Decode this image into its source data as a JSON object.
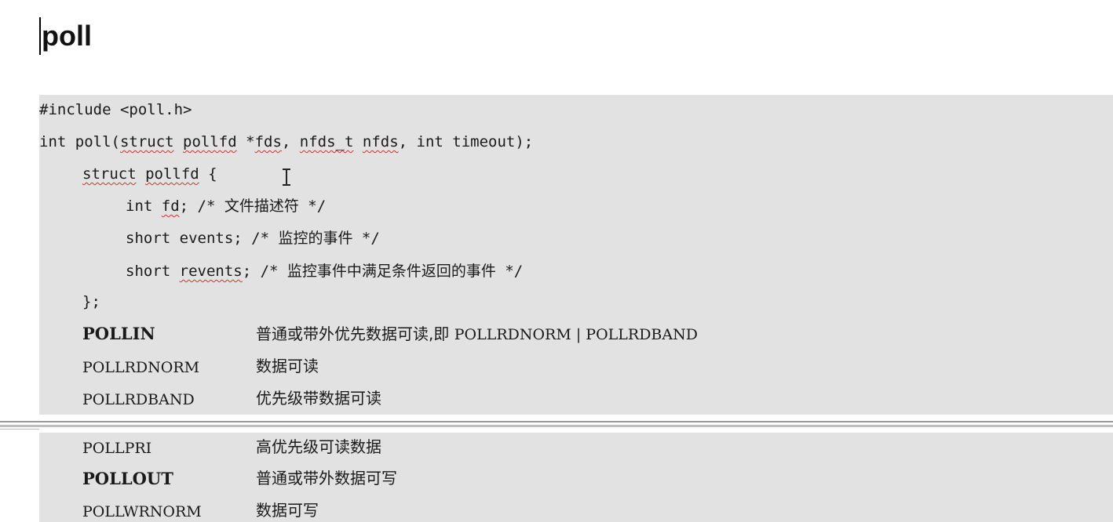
{
  "title": "poll",
  "code": {
    "include": "#include <poll.h>",
    "signature": {
      "prefix": "int poll(",
      "struct_kw": "struct",
      "type_name": "pollfd",
      "star": " *",
      "param1": "fds",
      "comma1": ", ",
      "type2": "nfds_t",
      "space": " ",
      "param2": "nfds",
      "suffix": ", int timeout);"
    },
    "struct_open": {
      "struct_kw": "struct",
      "type_name": "pollfd",
      "brace": " {"
    },
    "fields": [
      {
        "type": "int ",
        "name": "fd",
        "rest": "; /* 文件描述符 */"
      },
      {
        "type": "short ",
        "name": "events",
        "rest": "; /* 监控的事件 */"
      },
      {
        "type": "short ",
        "name": "revents",
        "rest": "; /* 监控事件中满足条件返回的事件 */"
      }
    ],
    "struct_close": "};"
  },
  "flags": [
    {
      "name": "POLLIN",
      "desc": "普通或带外优先数据可读,即 ",
      "extra": "POLLRDNORM | POLLRDBAND"
    },
    {
      "name": "POLLRDNORM",
      "desc": "数据可读"
    },
    {
      "name": "POLLRDBAND",
      "desc": "优先级带数据可读"
    },
    {
      "name": "POLLPRI",
      "desc": "高优先级可读数据"
    },
    {
      "name": "POLLOUT",
      "desc": "普通或带外数据可写"
    },
    {
      "name": "POLLWRNORM",
      "desc": "数据可写"
    }
  ]
}
